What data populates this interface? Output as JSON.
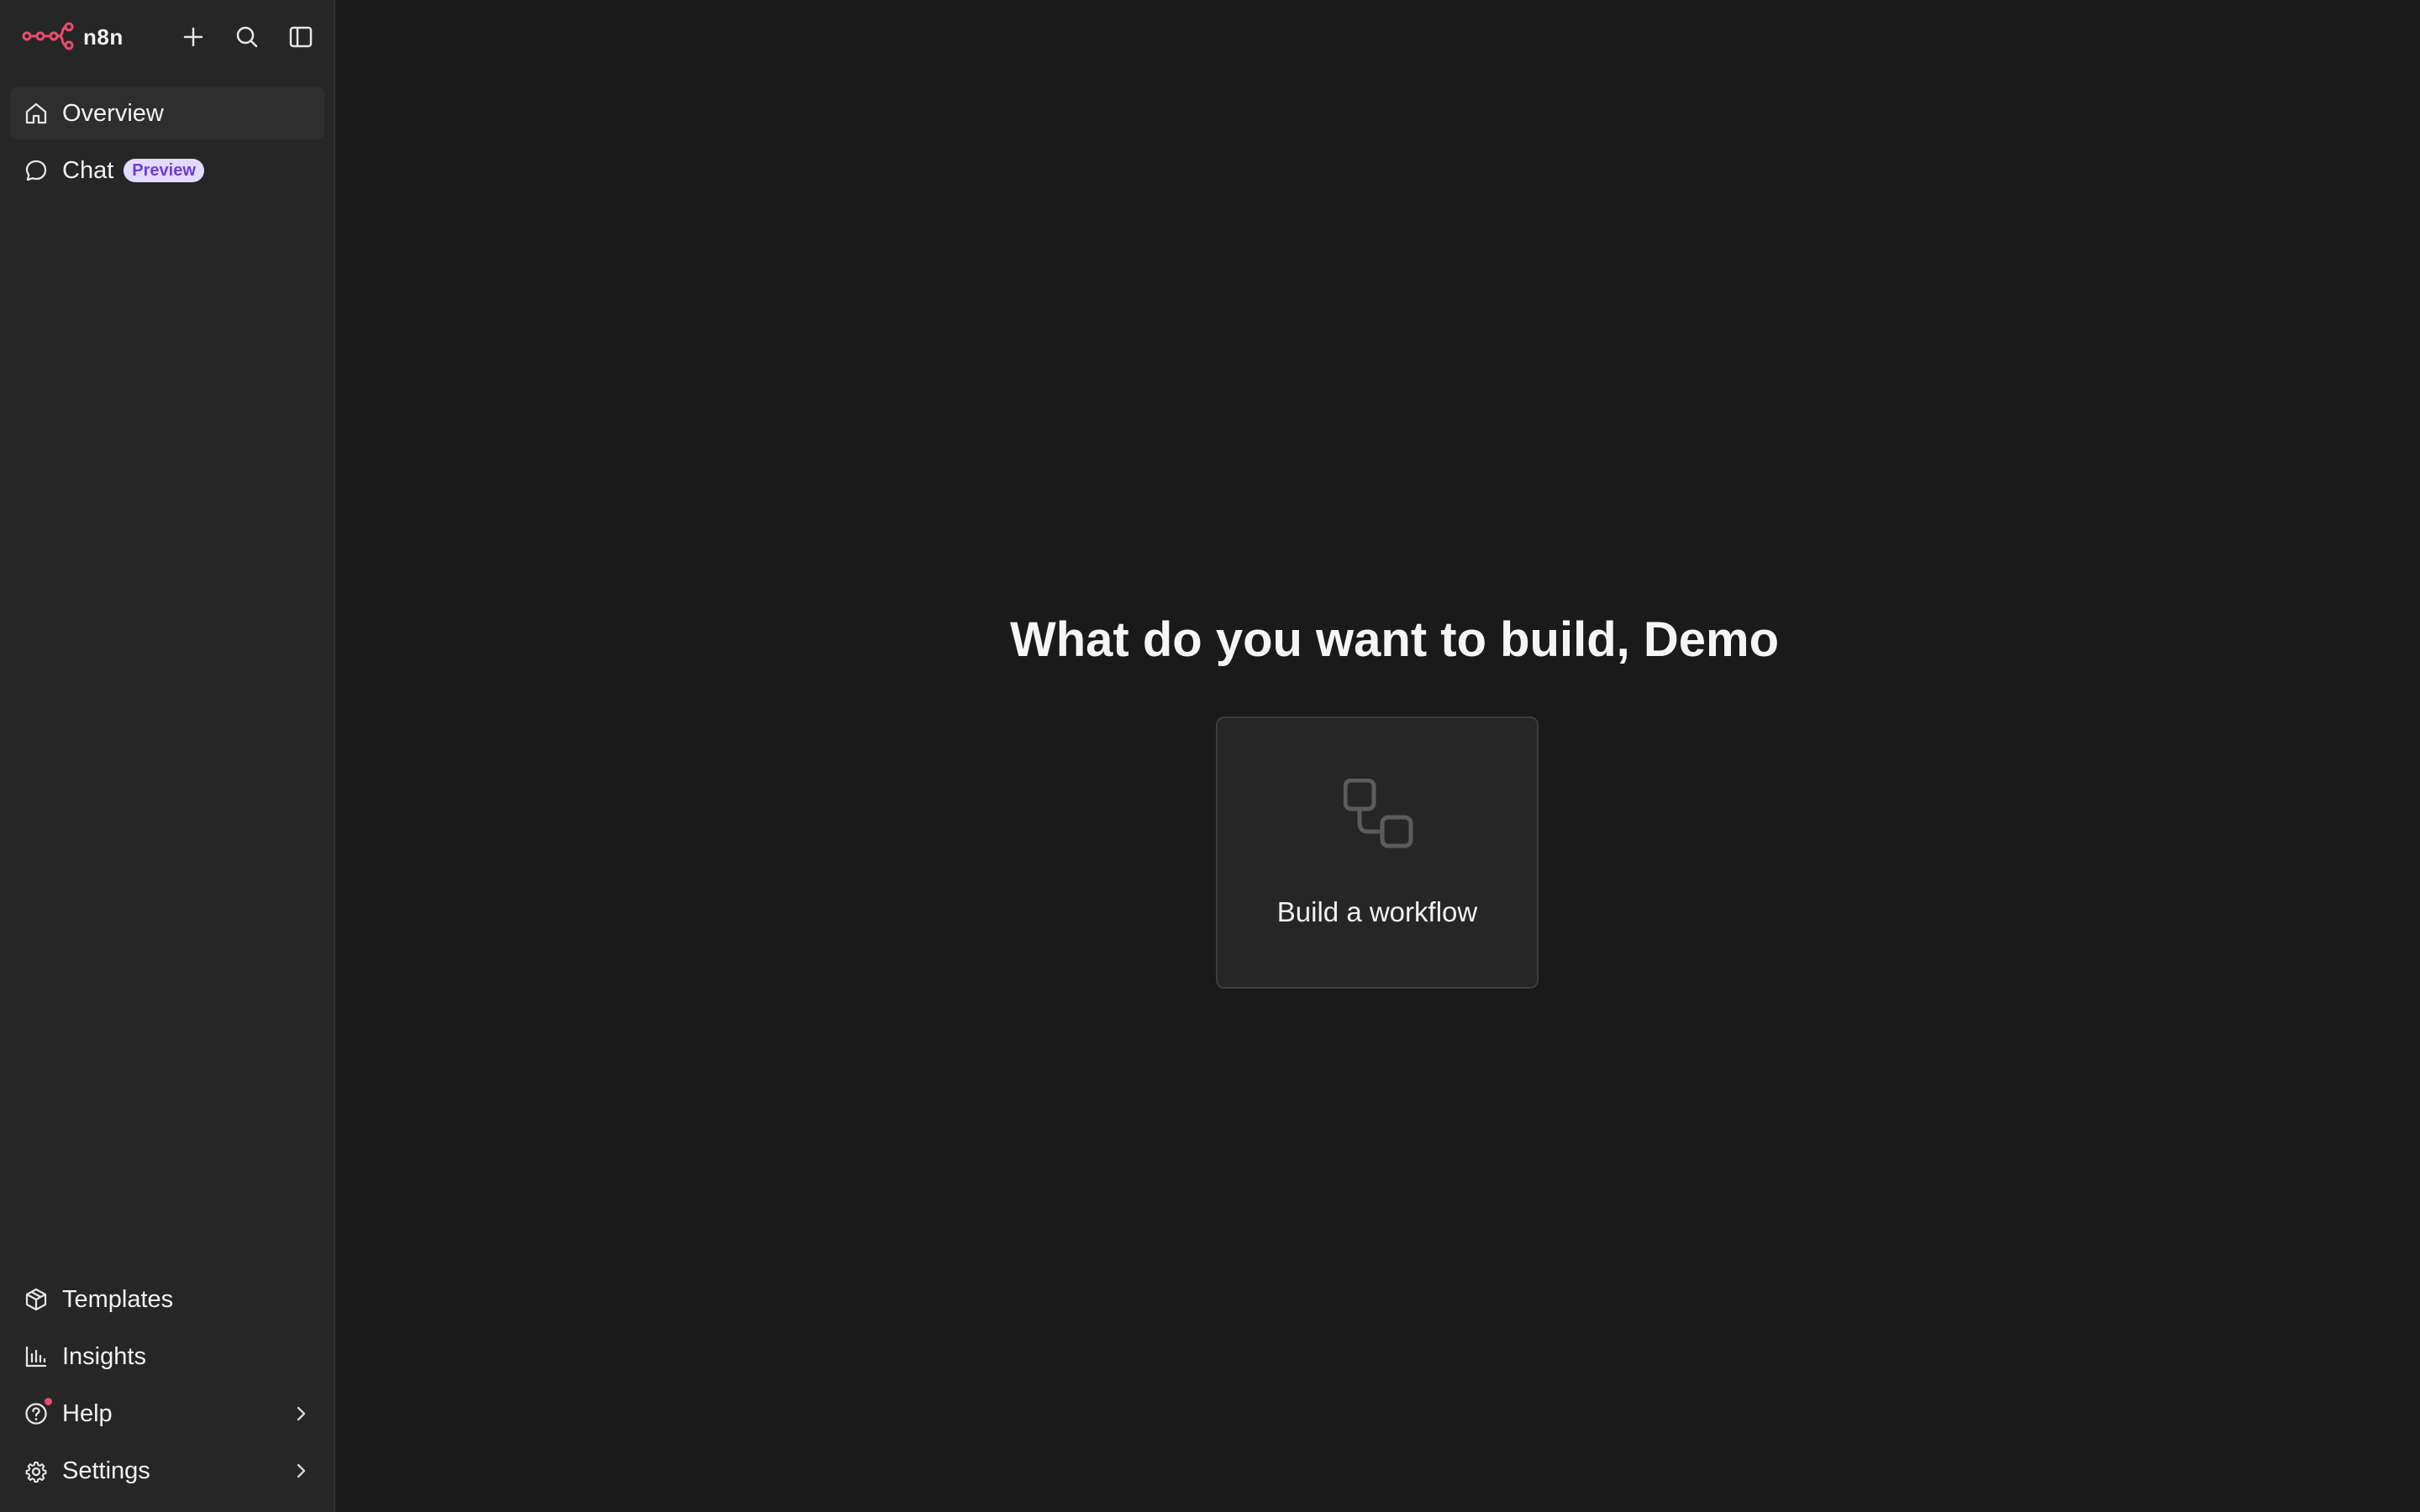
{
  "app": {
    "name": "n8n"
  },
  "colors": {
    "brand": "#ea4b71",
    "badge_bg": "#e4d9ff",
    "badge_text": "#6b3fd4",
    "background": "#1a1a1a",
    "sidebar": "#262626"
  },
  "sidebar": {
    "header_buttons": [
      {
        "name": "add",
        "icon": "plus-icon"
      },
      {
        "name": "search",
        "icon": "search-icon"
      },
      {
        "name": "toggle-sidebar",
        "icon": "panel-left-icon"
      }
    ],
    "top_items": [
      {
        "label": "Overview",
        "icon": "home-icon",
        "active": true
      },
      {
        "label": "Chat",
        "icon": "chat-bubble-icon",
        "badge": "Preview"
      }
    ],
    "bottom_items": [
      {
        "label": "Templates",
        "icon": "box-icon"
      },
      {
        "label": "Insights",
        "icon": "bar-chart-icon"
      },
      {
        "label": "Help",
        "icon": "help-circle-icon",
        "has_submenu": true,
        "notification": true
      },
      {
        "label": "Settings",
        "icon": "gear-icon",
        "has_submenu": true
      }
    ]
  },
  "main": {
    "headline": "What do you want to build, Demo",
    "cards": [
      {
        "label": "Build a workflow",
        "icon": "workflow-icon"
      }
    ]
  }
}
